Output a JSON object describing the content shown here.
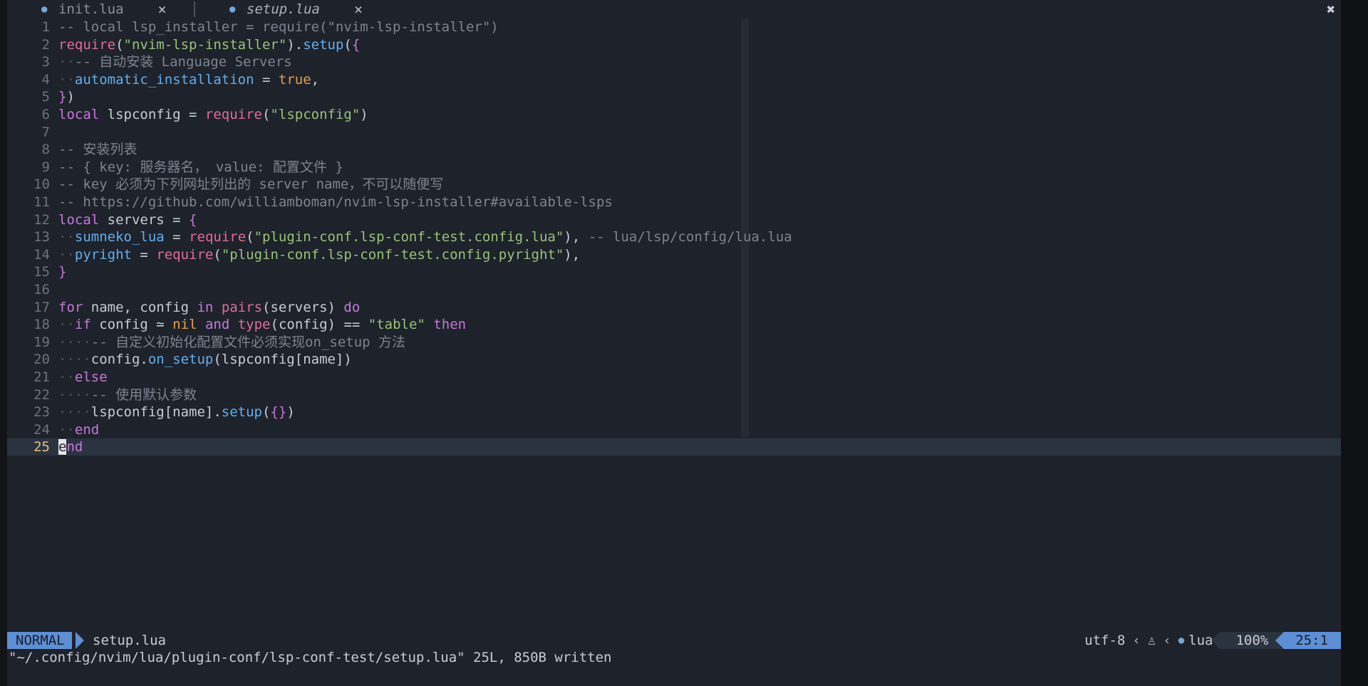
{
  "tabs": [
    {
      "label": "init.lua",
      "icon": "lua-file-icon",
      "close": "×"
    },
    {
      "label": "setup.lua",
      "icon": "lua-file-icon",
      "close": "×"
    }
  ],
  "tabbar_close": "✖",
  "lines": [
    {
      "n": "1",
      "tokens": [
        {
          "c": "cm",
          "t": "-- local lsp_installer = require(\"nvim-lsp-installer\")"
        }
      ]
    },
    {
      "n": "2",
      "tokens": [
        {
          "c": "fn",
          "t": "require"
        },
        {
          "c": "",
          "t": "("
        },
        {
          "c": "str",
          "t": "\"nvim-lsp-installer\""
        },
        {
          "c": "",
          "t": ")."
        },
        {
          "c": "key",
          "t": "setup"
        },
        {
          "c": "",
          "t": "("
        },
        {
          "c": "brk",
          "t": "{"
        }
      ]
    },
    {
      "n": "3",
      "tokens": [
        {
          "c": "lspace",
          "t": "··"
        },
        {
          "c": "cm",
          "t": "-- 自动安装 Language Servers"
        }
      ]
    },
    {
      "n": "4",
      "tokens": [
        {
          "c": "lspace",
          "t": "··"
        },
        {
          "c": "key",
          "t": "automatic_installation"
        },
        {
          "c": "",
          "t": " = "
        },
        {
          "c": "bool",
          "t": "true"
        },
        {
          "c": "",
          "t": ","
        }
      ]
    },
    {
      "n": "5",
      "tokens": [
        {
          "c": "brk",
          "t": "}"
        },
        {
          "c": "",
          "t": ")"
        }
      ]
    },
    {
      "n": "6",
      "tokens": [
        {
          "c": "kw",
          "t": "local"
        },
        {
          "c": "",
          "t": " lspconfig = "
        },
        {
          "c": "fn",
          "t": "require"
        },
        {
          "c": "",
          "t": "("
        },
        {
          "c": "str",
          "t": "\"lspconfig\""
        },
        {
          "c": "",
          "t": ")"
        }
      ]
    },
    {
      "n": "7",
      "tokens": []
    },
    {
      "n": "8",
      "tokens": [
        {
          "c": "cm",
          "t": "-- 安装列表"
        }
      ]
    },
    {
      "n": "9",
      "tokens": [
        {
          "c": "cm",
          "t": "-- { key: 服务器名， value: 配置文件 }"
        }
      ]
    },
    {
      "n": "10",
      "tokens": [
        {
          "c": "cm",
          "t": "-- key 必须为下列网址列出的 server name，不可以随便写"
        }
      ]
    },
    {
      "n": "11",
      "tokens": [
        {
          "c": "cm",
          "t": "-- https://github.com/williamboman/nvim-lsp-installer#available-lsps"
        }
      ]
    },
    {
      "n": "12",
      "tokens": [
        {
          "c": "kw",
          "t": "local"
        },
        {
          "c": "",
          "t": " servers = "
        },
        {
          "c": "brk",
          "t": "{"
        }
      ]
    },
    {
      "n": "13",
      "tokens": [
        {
          "c": "lspace",
          "t": "··"
        },
        {
          "c": "key",
          "t": "sumneko_lua"
        },
        {
          "c": "",
          "t": " = "
        },
        {
          "c": "fn",
          "t": "require"
        },
        {
          "c": "",
          "t": "("
        },
        {
          "c": "str",
          "t": "\"plugin-conf.lsp-conf-test.config.lua\""
        },
        {
          "c": "",
          "t": "), "
        },
        {
          "c": "cm",
          "t": "-- lua/lsp/config/lua.lua"
        }
      ]
    },
    {
      "n": "14",
      "tokens": [
        {
          "c": "lspace",
          "t": "··"
        },
        {
          "c": "key",
          "t": "pyright"
        },
        {
          "c": "",
          "t": " = "
        },
        {
          "c": "fn",
          "t": "require"
        },
        {
          "c": "",
          "t": "("
        },
        {
          "c": "str",
          "t": "\"plugin-conf.lsp-conf-test.config.pyright\""
        },
        {
          "c": "",
          "t": "),"
        }
      ]
    },
    {
      "n": "15",
      "tokens": [
        {
          "c": "brk",
          "t": "}"
        }
      ]
    },
    {
      "n": "16",
      "tokens": []
    },
    {
      "n": "17",
      "tokens": [
        {
          "c": "kw",
          "t": "for"
        },
        {
          "c": "",
          "t": " name, config "
        },
        {
          "c": "kw",
          "t": "in"
        },
        {
          "c": "",
          "t": " "
        },
        {
          "c": "fn",
          "t": "pairs"
        },
        {
          "c": "",
          "t": "(servers) "
        },
        {
          "c": "kw",
          "t": "do"
        }
      ]
    },
    {
      "n": "18",
      "tokens": [
        {
          "c": "lspace",
          "t": "··"
        },
        {
          "c": "kw",
          "t": "if"
        },
        {
          "c": "",
          "t": " config ≃ "
        },
        {
          "c": "bool",
          "t": "nil"
        },
        {
          "c": "",
          "t": " "
        },
        {
          "c": "kw",
          "t": "and"
        },
        {
          "c": "",
          "t": " "
        },
        {
          "c": "fn",
          "t": "type"
        },
        {
          "c": "",
          "t": "(config) == "
        },
        {
          "c": "str",
          "t": "\"table\""
        },
        {
          "c": "",
          "t": " "
        },
        {
          "c": "kw",
          "t": "then"
        }
      ]
    },
    {
      "n": "19",
      "tokens": [
        {
          "c": "lspace",
          "t": "····"
        },
        {
          "c": "cm",
          "t": "-- 自定义初始化配置文件必须实现on_setup 方法"
        }
      ]
    },
    {
      "n": "20",
      "tokens": [
        {
          "c": "lspace",
          "t": "····"
        },
        {
          "c": "",
          "t": "config."
        },
        {
          "c": "key",
          "t": "on_setup"
        },
        {
          "c": "",
          "t": "(lspconfig[name])"
        }
      ]
    },
    {
      "n": "21",
      "tokens": [
        {
          "c": "lspace",
          "t": "··"
        },
        {
          "c": "kw",
          "t": "else"
        }
      ]
    },
    {
      "n": "22",
      "tokens": [
        {
          "c": "lspace",
          "t": "····"
        },
        {
          "c": "cm",
          "t": "-- 使用默认参数"
        }
      ]
    },
    {
      "n": "23",
      "tokens": [
        {
          "c": "lspace",
          "t": "····"
        },
        {
          "c": "",
          "t": "lspconfig[name]."
        },
        {
          "c": "key",
          "t": "setup"
        },
        {
          "c": "",
          "t": "("
        },
        {
          "c": "brk",
          "t": "{}"
        },
        {
          "c": "",
          "t": ")"
        }
      ]
    },
    {
      "n": "24",
      "tokens": [
        {
          "c": "lspace",
          "t": "··"
        },
        {
          "c": "kw",
          "t": "end"
        }
      ]
    },
    {
      "n": "25",
      "tokens": [
        {
          "c": "cursor",
          "t": "e"
        },
        {
          "c": "kw",
          "t": "nd"
        }
      ],
      "current": true
    }
  ],
  "status": {
    "mode": "NORMAL",
    "file": "setup.lua",
    "encoding": "utf-8",
    "os_icon": "linux-penguin-icon",
    "os_glyph": "♙",
    "lang_icon": "lua-file-icon",
    "lang": "lua",
    "percent": "100%",
    "position": "25:1"
  },
  "cmdline": "\"~/.config/nvim/lua/plugin-conf/lsp-conf-test/setup.lua\" 25L, 850B written",
  "colors": {
    "background": "#1e222a",
    "mode_bg": "#5d8fd6",
    "comment": "#7d8490",
    "keyword": "#c678dd",
    "function": "#e06c9a",
    "string": "#98c379",
    "key": "#61afef",
    "boolean": "#e5a050"
  }
}
